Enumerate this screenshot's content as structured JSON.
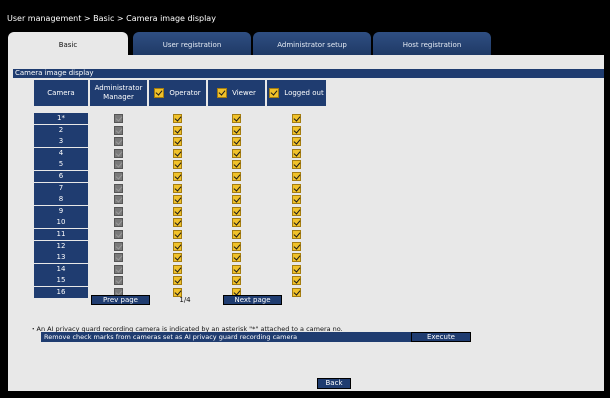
{
  "breadcrumb": "User management > Basic > Camera image display",
  "tabs": [
    {
      "label": "Basic",
      "active": true
    },
    {
      "label": "User registration",
      "active": false
    },
    {
      "label": "Administrator setup",
      "active": false
    },
    {
      "label": "Host registration",
      "active": false
    }
  ],
  "section_title": "Camera image display",
  "columns": {
    "camera": "Camera",
    "admin": "Administrator Manager",
    "operator": "Operator",
    "viewer": "Viewer",
    "loggedout": "Logged out"
  },
  "rows": [
    "1*",
    "2",
    "3",
    "4",
    "5",
    "6",
    "7",
    "8",
    "9",
    "10",
    "11",
    "12",
    "13",
    "14",
    "15",
    "16"
  ],
  "column_states": {
    "admin": {
      "checked": true,
      "enabled": false
    },
    "operator": {
      "checked": true,
      "enabled": true
    },
    "viewer": {
      "checked": true,
      "enabled": true
    },
    "loggedout": {
      "checked": true,
      "enabled": true
    }
  },
  "pagination": {
    "prev_label": "Prev page",
    "indicator": "1/4",
    "next_label": "Next page"
  },
  "note": "・An AI privacy guard recording camera is indicated by an asterisk \"*\" attached to a camera no.",
  "remove_text": "Remove check marks from cameras set as AI privacy guard recording camera",
  "execute_label": "Execute",
  "back_label": "Back",
  "colors": {
    "header_blue": "#1f3c70",
    "panel_gray": "#e8e8e8",
    "check_yellow": "#f0c12a",
    "disabled_gray": "#7a7a7a"
  }
}
